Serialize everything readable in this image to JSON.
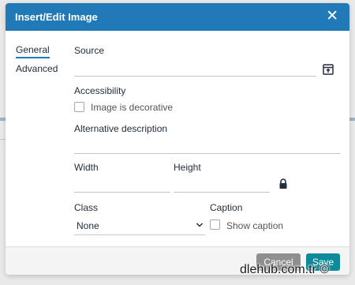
{
  "dialog": {
    "title": "Insert/Edit Image",
    "close_icon": "close-icon"
  },
  "nav": {
    "items": [
      {
        "label": "General",
        "active": true
      },
      {
        "label": "Advanced",
        "active": false
      }
    ]
  },
  "general": {
    "source_label": "Source",
    "source_value": "",
    "browse_icon": "browse-icon",
    "accessibility_label": "Accessibility",
    "decorative_label": "Image is decorative",
    "decorative_checked": false,
    "alt_label": "Alternative description",
    "alt_value": "",
    "width_label": "Width",
    "width_value": "",
    "height_label": "Height",
    "height_value": "",
    "lock_icon": "lock-icon",
    "class_label": "Class",
    "class_value": "None",
    "caption_label": "Caption",
    "show_caption_label": "Show caption",
    "show_caption_checked": false
  },
  "footer": {
    "cancel_label": "Cancel",
    "save_label": "Save"
  },
  "watermark": "dlehub.com.tr ©",
  "colors": {
    "header": "#207ab7",
    "save": "#0d8b98",
    "cancel": "#8f8f8f"
  }
}
